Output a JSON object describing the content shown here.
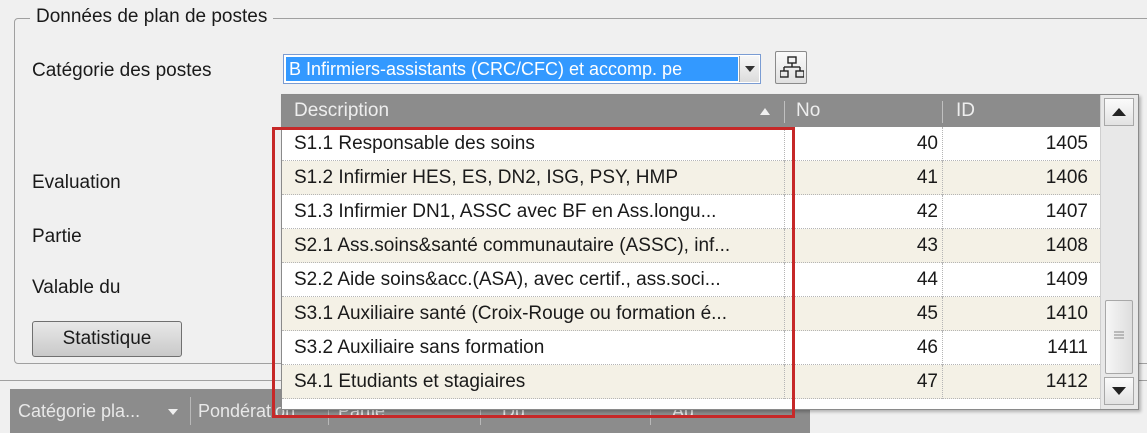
{
  "group": {
    "title": "Données de plan de postes",
    "labels": {
      "categorie": "Catégorie des postes",
      "evaluation": "Evaluation",
      "partie": "Partie",
      "valable": "Valable du"
    },
    "combo_value": "B Infirmiers-assistants (CRC/CFC) et accomp. pe",
    "statistique_label": "Statistique"
  },
  "dropdown": {
    "columns": {
      "description": "Description",
      "no": "No",
      "id": "ID"
    },
    "rows": [
      {
        "description": "S1.1 Responsable des soins",
        "no": "40",
        "id": "1405"
      },
      {
        "description": "S1.2 Infirmier HES, ES, DN2, ISG, PSY, HMP",
        "no": "41",
        "id": "1406"
      },
      {
        "description": "S1.3 Infirmier DN1, ASSC avec BF en Ass.longu...",
        "no": "42",
        "id": "1407"
      },
      {
        "description": "S2.1 Ass.soins&santé communautaire (ASSC), inf...",
        "no": "43",
        "id": "1408"
      },
      {
        "description": "S2.2 Aide soins&acc.(ASA), avec certif., ass.soci...",
        "no": "44",
        "id": "1409"
      },
      {
        "description": "S3.1 Auxiliaire santé (Croix-Rouge ou formation é...",
        "no": "45",
        "id": "1410"
      },
      {
        "description": "S3.2 Auxiliaire sans formation",
        "no": "46",
        "id": "1411"
      },
      {
        "description": "S4.1 Etudiants et stagiaires",
        "no": "47",
        "id": "1412"
      }
    ]
  },
  "bottom_grid": {
    "columns": [
      "Catégorie pla...",
      "Pondération",
      "Partie",
      "Du",
      "Au"
    ]
  },
  "colors": {
    "selection": "#3399ff",
    "header": "#8c8c8c",
    "row_alt": "#f4f1e6",
    "highlight": "#c62828"
  },
  "icons": {
    "combo_button": "chevron-down-icon",
    "tree_button": "org-chart-icon",
    "sort": "sort-ascending-icon",
    "scroll_up": "arrow-up-icon",
    "scroll_down": "arrow-down-icon"
  }
}
